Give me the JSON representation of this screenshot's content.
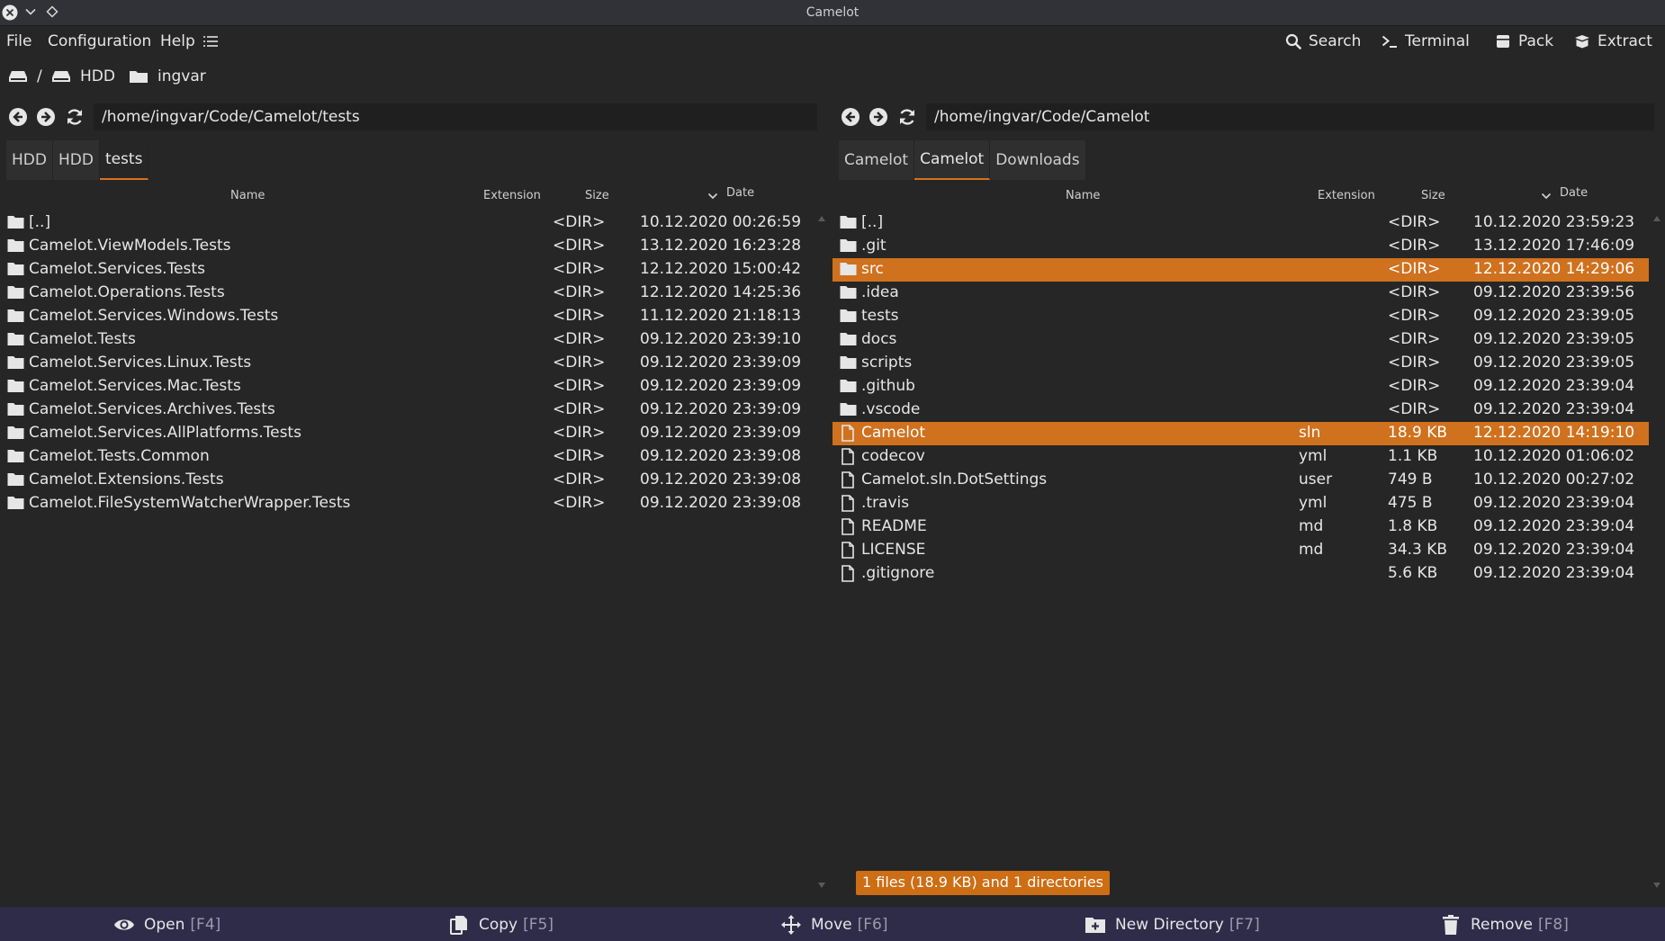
{
  "window": {
    "title": "Camelot"
  },
  "menu": {
    "file": "File",
    "configuration": "Configuration",
    "help": "Help"
  },
  "toolbar": {
    "search": "Search",
    "terminal": "Terminal",
    "pack": "Pack",
    "extract": "Extract"
  },
  "drives": {
    "root": "/",
    "hdd": "HDD",
    "home": "ingvar"
  },
  "columns": {
    "name": "Name",
    "extension": "Extension",
    "size": "Size",
    "date": "Date"
  },
  "left": {
    "path": "/home/ingvar/Code/Camelot/tests",
    "tabs": [
      {
        "label": "HDD"
      },
      {
        "label": "HDD"
      },
      {
        "label": "tests"
      }
    ],
    "active_tab": 2,
    "rows": [
      {
        "name": "[..]",
        "ext": "",
        "size": "<DIR>",
        "date": "10.12.2020 00:26:59",
        "type": "dir"
      },
      {
        "name": "Camelot.ViewModels.Tests",
        "ext": "",
        "size": "<DIR>",
        "date": "13.12.2020 16:23:28",
        "type": "dir"
      },
      {
        "name": "Camelot.Services.Tests",
        "ext": "",
        "size": "<DIR>",
        "date": "12.12.2020 15:00:42",
        "type": "dir"
      },
      {
        "name": "Camelot.Operations.Tests",
        "ext": "",
        "size": "<DIR>",
        "date": "12.12.2020 14:25:36",
        "type": "dir"
      },
      {
        "name": "Camelot.Services.Windows.Tests",
        "ext": "",
        "size": "<DIR>",
        "date": "11.12.2020 21:18:13",
        "type": "dir"
      },
      {
        "name": "Camelot.Tests",
        "ext": "",
        "size": "<DIR>",
        "date": "09.12.2020 23:39:10",
        "type": "dir"
      },
      {
        "name": "Camelot.Services.Linux.Tests",
        "ext": "",
        "size": "<DIR>",
        "date": "09.12.2020 23:39:09",
        "type": "dir"
      },
      {
        "name": "Camelot.Services.Mac.Tests",
        "ext": "",
        "size": "<DIR>",
        "date": "09.12.2020 23:39:09",
        "type": "dir"
      },
      {
        "name": "Camelot.Services.Archives.Tests",
        "ext": "",
        "size": "<DIR>",
        "date": "09.12.2020 23:39:09",
        "type": "dir"
      },
      {
        "name": "Camelot.Services.AllPlatforms.Tests",
        "ext": "",
        "size": "<DIR>",
        "date": "09.12.2020 23:39:09",
        "type": "dir"
      },
      {
        "name": "Camelot.Tests.Common",
        "ext": "",
        "size": "<DIR>",
        "date": "09.12.2020 23:39:08",
        "type": "dir"
      },
      {
        "name": "Camelot.Extensions.Tests",
        "ext": "",
        "size": "<DIR>",
        "date": "09.12.2020 23:39:08",
        "type": "dir"
      },
      {
        "name": "Camelot.FileSystemWatcherWrapper.Tests",
        "ext": "",
        "size": "<DIR>",
        "date": "09.12.2020 23:39:08",
        "type": "dir"
      }
    ]
  },
  "right": {
    "path": "/home/ingvar/Code/Camelot",
    "tabs": [
      {
        "label": "Camelot"
      },
      {
        "label": "Camelot"
      },
      {
        "label": "Downloads"
      }
    ],
    "active_tab": 1,
    "rows": [
      {
        "name": "[..]",
        "ext": "",
        "size": "<DIR>",
        "date": "10.12.2020 23:59:23",
        "type": "dir",
        "selected": false
      },
      {
        "name": ".git",
        "ext": "",
        "size": "<DIR>",
        "date": "13.12.2020 17:46:09",
        "type": "dir",
        "selected": false
      },
      {
        "name": "src",
        "ext": "",
        "size": "<DIR>",
        "date": "12.12.2020 14:29:06",
        "type": "dir",
        "selected": true
      },
      {
        "name": ".idea",
        "ext": "",
        "size": "<DIR>",
        "date": "09.12.2020 23:39:56",
        "type": "dir",
        "selected": false
      },
      {
        "name": "tests",
        "ext": "",
        "size": "<DIR>",
        "date": "09.12.2020 23:39:05",
        "type": "dir",
        "selected": false
      },
      {
        "name": "docs",
        "ext": "",
        "size": "<DIR>",
        "date": "09.12.2020 23:39:05",
        "type": "dir",
        "selected": false
      },
      {
        "name": "scripts",
        "ext": "",
        "size": "<DIR>",
        "date": "09.12.2020 23:39:05",
        "type": "dir",
        "selected": false
      },
      {
        "name": ".github",
        "ext": "",
        "size": "<DIR>",
        "date": "09.12.2020 23:39:04",
        "type": "dir",
        "selected": false
      },
      {
        "name": ".vscode",
        "ext": "",
        "size": "<DIR>",
        "date": "09.12.2020 23:39:04",
        "type": "dir",
        "selected": false
      },
      {
        "name": "Camelot",
        "ext": "sln",
        "size": "18.9 KB",
        "date": "12.12.2020 14:19:10",
        "type": "file",
        "selected": true
      },
      {
        "name": "codecov",
        "ext": "yml",
        "size": "1.1 KB",
        "date": "10.12.2020 01:06:02",
        "type": "file",
        "selected": false
      },
      {
        "name": "Camelot.sln.DotSettings",
        "ext": "user",
        "size": "749 B",
        "date": "10.12.2020 00:27:02",
        "type": "file",
        "selected": false
      },
      {
        "name": ".travis",
        "ext": "yml",
        "size": "475 B",
        "date": "09.12.2020 23:39:04",
        "type": "file",
        "selected": false
      },
      {
        "name": "README",
        "ext": "md",
        "size": "1.8 KB",
        "date": "09.12.2020 23:39:04",
        "type": "file",
        "selected": false
      },
      {
        "name": "LICENSE",
        "ext": "md",
        "size": "34.3 KB",
        "date": "09.12.2020 23:39:04",
        "type": "file",
        "selected": false
      },
      {
        "name": ".gitignore",
        "ext": "",
        "size": "5.6 KB",
        "date": "09.12.2020 23:39:04",
        "type": "file",
        "selected": false
      }
    ],
    "status": "1 files (18.9 KB) and 1 directories"
  },
  "bottom": [
    {
      "id": "open",
      "label": "Open",
      "key": "[F4]"
    },
    {
      "id": "copy",
      "label": "Copy",
      "key": "[F5]"
    },
    {
      "id": "move",
      "label": "Move",
      "key": "[F6]"
    },
    {
      "id": "newdir",
      "label": "New Directory",
      "key": "[F7]"
    },
    {
      "id": "remove",
      "label": "Remove",
      "key": "[F8]"
    }
  ],
  "colors": {
    "accent": "#d0711e",
    "bottom_bar": "#2f2c49",
    "background": "#262626"
  }
}
